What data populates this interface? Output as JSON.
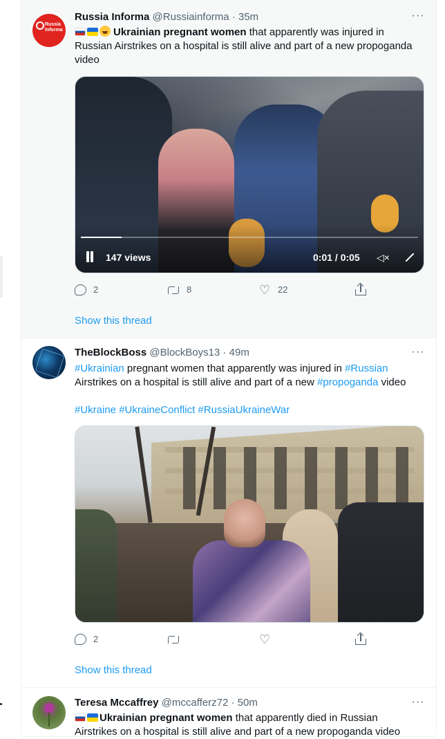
{
  "tweets": [
    {
      "name": "Russia Informa",
      "handle": "@Russiainforma",
      "time": "35m",
      "avatar_text": "Russia Informa",
      "text_bold": "Ukrainian pregnant women",
      "text_rest": " that apparently was injured in Russian Airstrikes on a hospital is still alive and part of a new propoganda video",
      "video": {
        "views": "147 views",
        "timecode": "0:01 / 0:05",
        "progress": 0.12
      },
      "replies": "2",
      "retweets": "8",
      "likes": "22",
      "show_thread": "Show this thread"
    },
    {
      "name": "TheBlockBoss",
      "handle": "@BlockBoys13",
      "time": "49m",
      "tag1": "#Ukrainian",
      "text_mid1": " pregnant women that apparently was injured in ",
      "tag2": "#Russian",
      "text_mid2": " Airstrikes on a hospital is still alive and part of a new ",
      "tag3": "#propoganda",
      "text_end": " video",
      "hashtags": [
        "#Ukraine",
        "#UkraineConflict",
        "#RussiaUkraineWar"
      ],
      "replies": "2",
      "show_thread": "Show this thread"
    },
    {
      "name": "Teresa Mccaffrey",
      "handle": "@mccafferz72",
      "time": "50m",
      "text_bold": "Ukrainian pregnant women",
      "text_rest": " that apparently died in Russian Airstrikes on a hospital is still alive and part of a new propoganda video"
    }
  ],
  "separator": "·",
  "more_glyph": "···",
  "colors": {
    "link": "#1d9bf0",
    "muted": "#536471",
    "highlight_bg": "#f7f9f9"
  },
  "icons": [
    "reply-icon",
    "retweet-icon",
    "like-icon",
    "share-icon",
    "pause-icon",
    "mute-icon",
    "fullscreen-icon",
    "more-icon"
  ]
}
